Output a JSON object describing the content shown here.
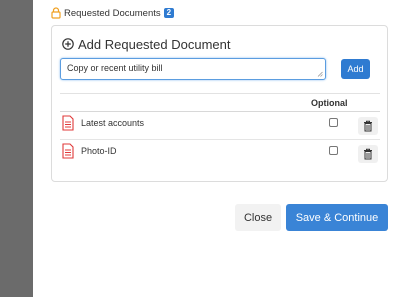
{
  "section": {
    "title": "Requested Documents",
    "count": "2"
  },
  "add_panel": {
    "title": "Add Requested Document",
    "input_value": "Copy or recent utility bill",
    "add_label": "Add"
  },
  "table": {
    "optional_header": "Optional",
    "rows": [
      {
        "name": "Latest accounts",
        "optional": false,
        "icon": "pdf-document-icon"
      },
      {
        "name": "Photo-ID",
        "optional": false,
        "icon": "pdf-document-icon"
      }
    ]
  },
  "footer": {
    "close_label": "Close",
    "save_label": "Save & Continue"
  },
  "colors": {
    "accent": "#2f7bd1",
    "pdf_red": "#e03a3a",
    "lock_orange": "#f0a020",
    "rail_gray": "#6b6b6b"
  }
}
